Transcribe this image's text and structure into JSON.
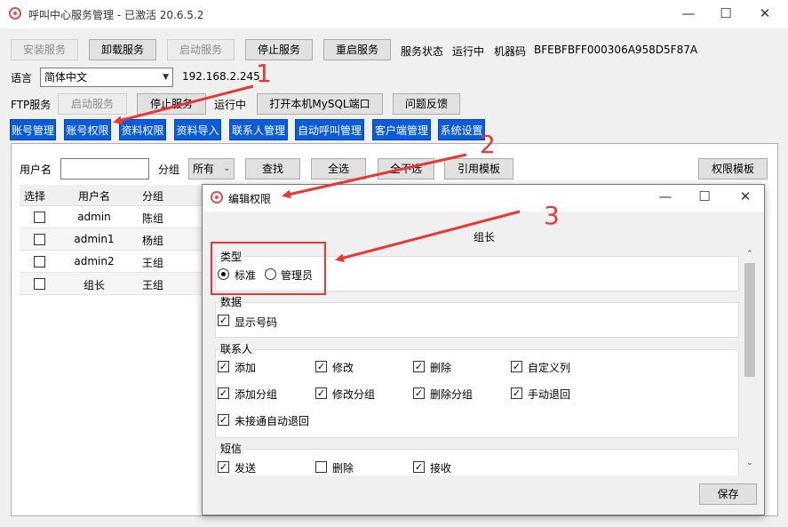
{
  "window": {
    "title": "呼叫中心服务管理 - 已激活  20.6.5.2",
    "controls": {
      "minimize": "—",
      "maximize": "☐",
      "close": "✕"
    }
  },
  "service_toolbar": {
    "install": "安装服务",
    "uninstall": "卸载服务",
    "start": "启动服务",
    "stop": "停止服务",
    "restart": "重启服务",
    "status_label": "服务状态",
    "status_value": "运行中",
    "machine_code_label": "机器码",
    "machine_code_value": "BFEBFBFF000306A958D5F87A"
  },
  "language": {
    "label": "语言",
    "selected": "简体中文",
    "ip": "192.168.2.245"
  },
  "ftp": {
    "label": "FTP服务",
    "start": "启动服务",
    "stop": "停止服务",
    "status": "运行中",
    "open_mysql": "打开本机MySQL端口",
    "feedback": "问题反馈"
  },
  "tabs": [
    "账号管理",
    "账号权限",
    "资料权限",
    "资料导入",
    "联系人管理",
    "自动呼叫管理",
    "客户端管理",
    "系统设置"
  ],
  "filter": {
    "username_label": "用户名",
    "username_value": "",
    "group_label": "分组",
    "group_selected": "所有",
    "search": "查找",
    "select_all": "全选",
    "deselect_all": "全不选",
    "apply_template": "引用模板",
    "perm_template": "权限模板"
  },
  "grid": {
    "headers": [
      "选择",
      "用户名",
      "分组"
    ],
    "rows": [
      {
        "checked": false,
        "username": "admin",
        "group": "陈组"
      },
      {
        "checked": false,
        "username": "admin1",
        "group": "杨组"
      },
      {
        "checked": false,
        "username": "admin2",
        "group": "王组"
      },
      {
        "checked": false,
        "username": "组长",
        "group": "王组"
      }
    ]
  },
  "dialog": {
    "title": "编辑权限",
    "subject": "组长",
    "type_section": {
      "label": "类型",
      "options": [
        {
          "label": "标准",
          "selected": true
        },
        {
          "label": "管理员",
          "selected": false
        }
      ]
    },
    "data_section": {
      "label": "数据",
      "items": [
        {
          "label": "显示号码",
          "checked": true
        }
      ]
    },
    "contacts_section": {
      "label": "联系人",
      "items": [
        {
          "label": "添加",
          "checked": true
        },
        {
          "label": "修改",
          "checked": true
        },
        {
          "label": "删除",
          "checked": true
        },
        {
          "label": "自定义列",
          "checked": true
        },
        {
          "label": "添加分组",
          "checked": true
        },
        {
          "label": "修改分组",
          "checked": true
        },
        {
          "label": "删除分组",
          "checked": true
        },
        {
          "label": "手动退回",
          "checked": true
        },
        {
          "label": "未接通自动退回",
          "checked": true
        }
      ]
    },
    "sms_section": {
      "label": "短信",
      "items": [
        {
          "label": "发送",
          "checked": true
        },
        {
          "label": "删除",
          "checked": false
        },
        {
          "label": "接收",
          "checked": true
        }
      ]
    },
    "save": "保存"
  },
  "annotations": {
    "step1": "1",
    "step2": "2",
    "step3": "3",
    "color": "#e53935"
  }
}
